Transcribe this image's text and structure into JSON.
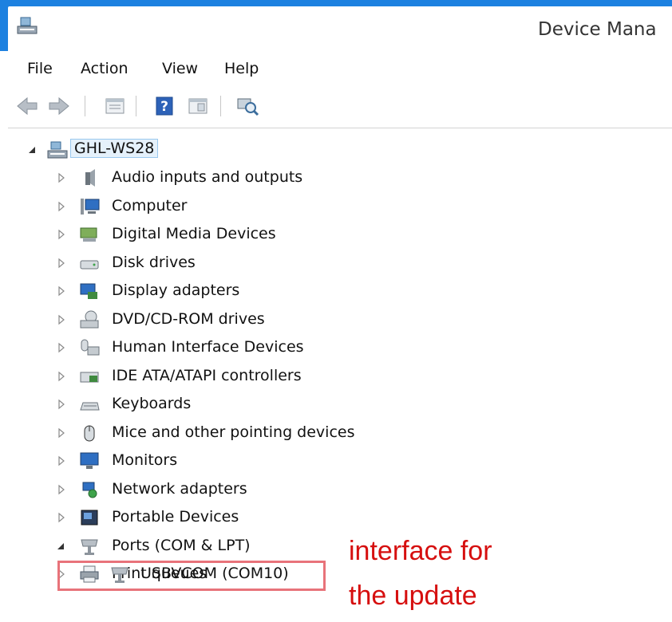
{
  "window": {
    "title": "Device Mana"
  },
  "menu": {
    "items": [
      "File",
      "Action",
      "View",
      "Help"
    ]
  },
  "toolbar": {
    "buttons": [
      "back-arrow-icon",
      "forward-arrow-icon",
      "properties-icon",
      "help-icon",
      "show-hide-icon",
      "scan-hardware-icon"
    ]
  },
  "tree": {
    "root": {
      "label": "GHL-WS28",
      "expanded": true
    },
    "categories": [
      {
        "label": "Audio inputs and outputs",
        "icon": "speaker-icon",
        "expanded": false
      },
      {
        "label": "Computer",
        "icon": "computer-icon",
        "expanded": false
      },
      {
        "label": "Digital Media Devices",
        "icon": "media-device-icon",
        "expanded": false
      },
      {
        "label": "Disk drives",
        "icon": "disk-drive-icon",
        "expanded": false
      },
      {
        "label": "Display adapters",
        "icon": "display-adapter-icon",
        "expanded": false
      },
      {
        "label": "DVD/CD-ROM drives",
        "icon": "dvd-drive-icon",
        "expanded": false
      },
      {
        "label": "Human Interface Devices",
        "icon": "hid-icon",
        "expanded": false
      },
      {
        "label": "IDE ATA/ATAPI controllers",
        "icon": "ide-controller-icon",
        "expanded": false
      },
      {
        "label": "Keyboards",
        "icon": "keyboard-icon",
        "expanded": false
      },
      {
        "label": "Mice and other pointing devices",
        "icon": "mouse-icon",
        "expanded": false
      },
      {
        "label": "Monitors",
        "icon": "monitor-icon",
        "expanded": false
      },
      {
        "label": "Network adapters",
        "icon": "network-adapter-icon",
        "expanded": false
      },
      {
        "label": "Portable Devices",
        "icon": "portable-device-icon",
        "expanded": false
      },
      {
        "label": "Ports (COM & LPT)",
        "icon": "port-icon",
        "expanded": true
      },
      {
        "label": "Print queues",
        "icon": "printer-icon",
        "expanded": false
      }
    ],
    "port_child": {
      "label": "USBVCOM (COM10)",
      "icon": "port-icon"
    }
  },
  "annotation": {
    "line1": "interface for",
    "line2": "the update",
    "color": "#d60f0f"
  }
}
